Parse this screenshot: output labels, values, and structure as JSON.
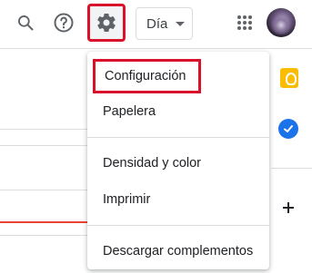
{
  "toolbar": {
    "view_label": "Día"
  },
  "menu": {
    "items": [
      {
        "label": "Configuración",
        "highlighted": true
      },
      {
        "label": "Papelera"
      },
      {
        "label": "Densidad y color"
      },
      {
        "label": "Imprimir"
      },
      {
        "label": "Descargar complementos"
      }
    ]
  },
  "icons": {
    "search": "search-icon",
    "help": "help-icon",
    "settings": "gear-icon",
    "apps": "apps-grid-icon",
    "keep": "keep-icon",
    "tasks": "tasks-icon",
    "add": "plus-icon"
  },
  "colors": {
    "highlight_border": "#d9112a",
    "keep": "#fbbc04",
    "tasks": "#1a73e8",
    "current_time_line": "#ea4335"
  }
}
